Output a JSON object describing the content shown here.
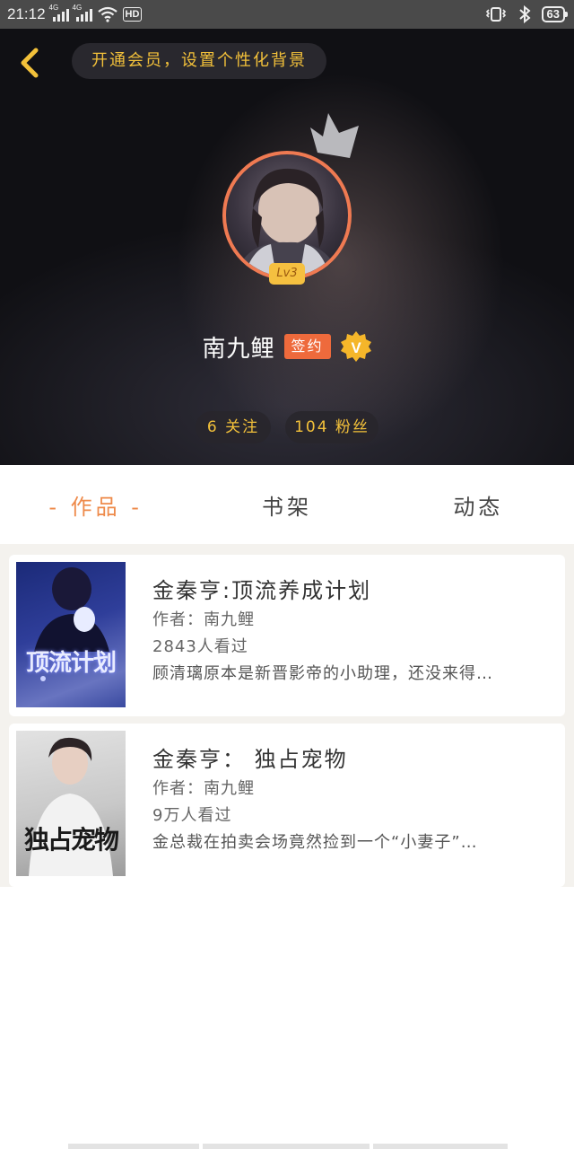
{
  "status_bar": {
    "time": "21:12",
    "network_1": "4G",
    "network_2": "4G",
    "hd_label": "HD",
    "battery": "63"
  },
  "header": {
    "vip_banner": "开通会员，设置个性化背景",
    "level": "Lv3",
    "name": "南九鲤",
    "signed_tag": "签约",
    "verified_icon": "v-badge-icon",
    "follow_stat": "6 关注",
    "fans_stat": "104 粉丝"
  },
  "tabs": [
    {
      "label": "- 作品 -",
      "active": true
    },
    {
      "label": "书架",
      "active": false
    },
    {
      "label": "动态",
      "active": false
    }
  ],
  "books": [
    {
      "title": "金秦亨:顶流养成计划",
      "author": "作者：南九鲤",
      "views": "2843人看过",
      "desc": "顾清璃原本是新晋影帝的小助理，还没来得…",
      "cover_text": "顶流计划"
    },
    {
      "title": "金秦亨： 独占宠物",
      "author": "作者：南九鲤",
      "views": "9万人看过",
      "desc": "金总裁在拍卖会场竟然捡到一个“小妻子”…",
      "cover_text": "独占宠物"
    }
  ],
  "colors": {
    "accent_orange": "#ee8a4a",
    "gold": "#f3c13a",
    "signed_tag": "#ee6a3c"
  }
}
